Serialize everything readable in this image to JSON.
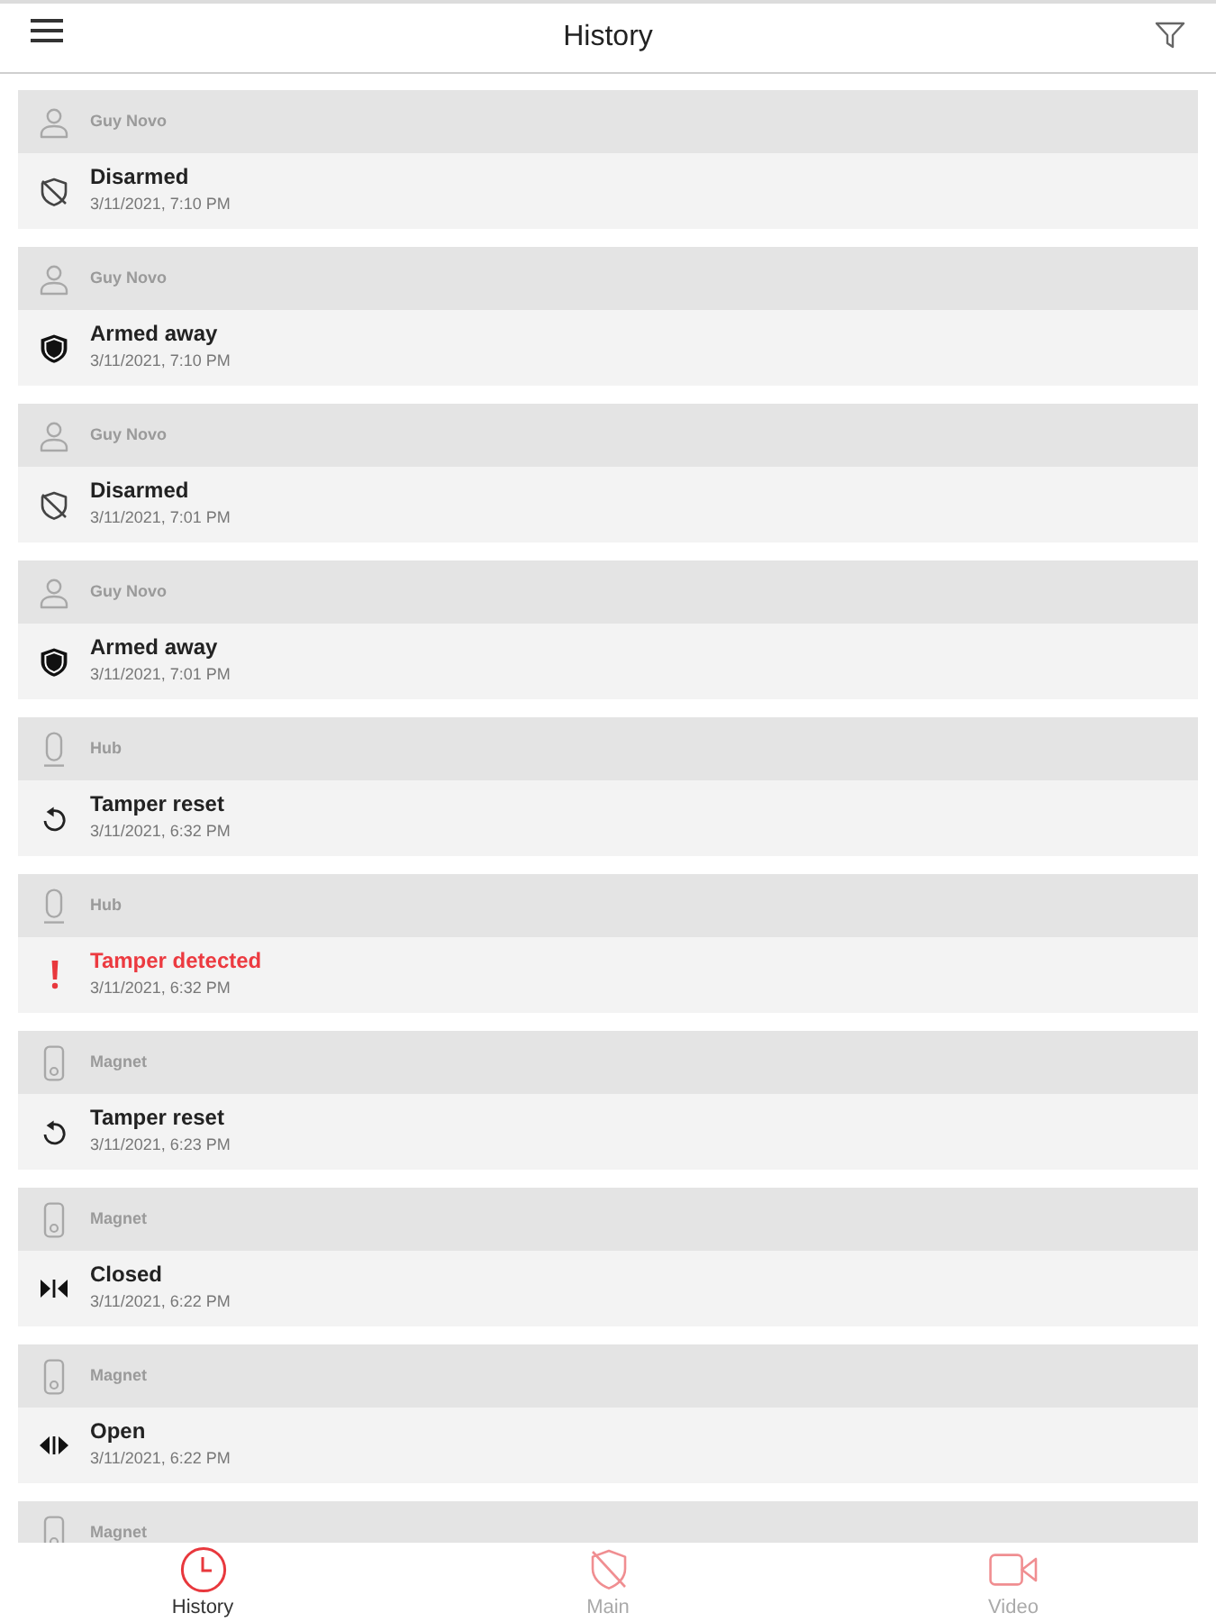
{
  "top_bar": {
    "title": "History"
  },
  "events": [
    {
      "source": {
        "kind": "user",
        "name": "Guy Novo"
      },
      "event": {
        "kind": "disarmed",
        "title": "Disarmed",
        "time": "3/11/2021, 7:10 PM",
        "alert": false
      }
    },
    {
      "source": {
        "kind": "user",
        "name": "Guy Novo"
      },
      "event": {
        "kind": "armed",
        "title": "Armed away",
        "time": "3/11/2021, 7:10 PM",
        "alert": false
      }
    },
    {
      "source": {
        "kind": "user",
        "name": "Guy Novo"
      },
      "event": {
        "kind": "disarmed",
        "title": "Disarmed",
        "time": "3/11/2021, 7:01 PM",
        "alert": false
      }
    },
    {
      "source": {
        "kind": "user",
        "name": "Guy Novo"
      },
      "event": {
        "kind": "armed",
        "title": "Armed away",
        "time": "3/11/2021, 7:01 PM",
        "alert": false
      }
    },
    {
      "source": {
        "kind": "hub",
        "name": "Hub"
      },
      "event": {
        "kind": "tamper_reset",
        "title": "Tamper reset",
        "time": "3/11/2021, 6:32 PM",
        "alert": false
      }
    },
    {
      "source": {
        "kind": "hub",
        "name": "Hub"
      },
      "event": {
        "kind": "tamper_detected",
        "title": "Tamper detected",
        "time": "3/11/2021, 6:32 PM",
        "alert": true
      }
    },
    {
      "source": {
        "kind": "magnet",
        "name": "Magnet"
      },
      "event": {
        "kind": "tamper_reset",
        "title": "Tamper reset",
        "time": "3/11/2021, 6:23 PM",
        "alert": false
      }
    },
    {
      "source": {
        "kind": "magnet",
        "name": "Magnet"
      },
      "event": {
        "kind": "closed",
        "title": "Closed",
        "time": "3/11/2021, 6:22 PM",
        "alert": false
      }
    },
    {
      "source": {
        "kind": "magnet",
        "name": "Magnet"
      },
      "event": {
        "kind": "open",
        "title": "Open",
        "time": "3/11/2021, 6:22 PM",
        "alert": false
      }
    },
    {
      "source": {
        "kind": "magnet",
        "name": "Magnet"
      }
    }
  ],
  "bottom_nav": [
    {
      "kind": "history",
      "label": "History",
      "selected": true
    },
    {
      "kind": "main",
      "label": "Main",
      "selected": false
    },
    {
      "kind": "video",
      "label": "Video",
      "selected": false
    }
  ]
}
